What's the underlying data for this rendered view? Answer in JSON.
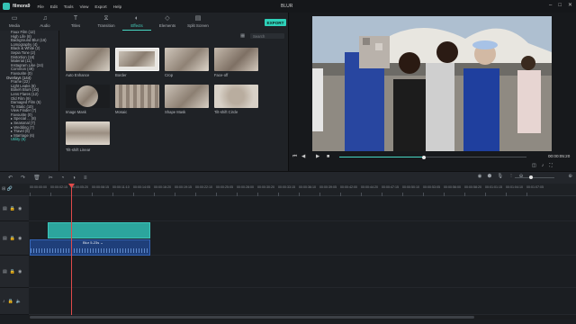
{
  "app": {
    "name": "filmora9",
    "doc_title": "BLUR",
    "menu": [
      "File",
      "Edit",
      "Tools",
      "View",
      "Export",
      "Help"
    ]
  },
  "toolbar": {
    "tabs": [
      {
        "label": "Media",
        "icon": "folder-icon"
      },
      {
        "label": "Audio",
        "icon": "music-note-icon"
      },
      {
        "label": "Titles",
        "icon": "titles-icon"
      },
      {
        "label": "Transition",
        "icon": "transition-icon"
      },
      {
        "label": "Effects",
        "icon": "effects-icon",
        "active": true
      },
      {
        "label": "Elements",
        "icon": "elements-icon"
      },
      {
        "label": "Split Screen",
        "icon": "split-screen-icon"
      }
    ],
    "export_label": "EXPORT"
  },
  "categories": [
    {
      "label": "Faux Film (12)",
      "type": "item"
    },
    {
      "label": "High Life (8)",
      "type": "item"
    },
    {
      "label": "Background Blur (16)",
      "type": "item"
    },
    {
      "label": "Lomography (4)",
      "type": "item"
    },
    {
      "label": "Black & White (2)",
      "type": "item"
    },
    {
      "label": "Sepia Tone (2)",
      "type": "item"
    },
    {
      "label": "Distortion (18)",
      "type": "item"
    },
    {
      "label": "Material (11)",
      "type": "item"
    },
    {
      "label": "Instagram Like (24)",
      "type": "item"
    },
    {
      "label": "Common (49)",
      "type": "item"
    },
    {
      "label": "Favourite (0)",
      "type": "item"
    },
    {
      "label": "Overlays (144)",
      "type": "hdr"
    },
    {
      "label": "Frame (22)",
      "type": "item"
    },
    {
      "label": "Light Leaks (6)",
      "type": "item"
    },
    {
      "label": "Bokeh Blurs (10)",
      "type": "item"
    },
    {
      "label": "Lens Flares (12)",
      "type": "item"
    },
    {
      "label": "Old Film (9)",
      "type": "item"
    },
    {
      "label": "Damaged Film (5)",
      "type": "item"
    },
    {
      "label": "Tv Static (10)",
      "type": "item"
    },
    {
      "label": "View Finder (7)",
      "type": "item"
    },
    {
      "label": "Favourite (0)",
      "type": "item"
    },
    {
      "label": "▸ Special ... (8)",
      "type": "item"
    },
    {
      "label": "▸ Seasonal (7)",
      "type": "item"
    },
    {
      "label": "▸ Wedding (7)",
      "type": "item"
    },
    {
      "label": "▸ Travel (6)",
      "type": "item"
    },
    {
      "label": "▸ Marriage (6)",
      "type": "item"
    },
    {
      "label": "Utility (6)",
      "type": "sel"
    }
  ],
  "search": {
    "placeholder": "Search"
  },
  "effects": [
    {
      "label": "Auto Enhance"
    },
    {
      "label": "Border"
    },
    {
      "label": "Crop"
    },
    {
      "label": "Face-off"
    },
    {
      "label": "Image Mask"
    },
    {
      "label": "Mosaic"
    },
    {
      "label": "Shape Mask"
    },
    {
      "label": "Tilt-shift Circle"
    },
    {
      "label": "Tilt-shift Linear"
    }
  ],
  "preview": {
    "timecode": "00:00:05:20",
    "progress": 0.45
  },
  "ruler_ticks": [
    "00:00:00:00",
    "00:00:02:15",
    "00:00:05:20",
    "00:00:08:15",
    "00:00:11:10",
    "00:00:14:05",
    "00:00:16:20",
    "00:00:19:15",
    "00:00:22:10",
    "00:00:25:05",
    "00:00:28:00",
    "00:00:30:20",
    "00:00:33:15",
    "00:00:36:10",
    "00:00:39:05",
    "00:00:42:00",
    "00:00:44:20",
    "00:00:47:15",
    "00:00:50:10",
    "00:00:53:05",
    "00:00:56:00",
    "00:00:58:20",
    "00:01:01:15",
    "00:01:04:10",
    "00:01:07:05"
  ],
  "timeline": {
    "audio_clip_label": "Blur 5-23s  ⌄"
  }
}
